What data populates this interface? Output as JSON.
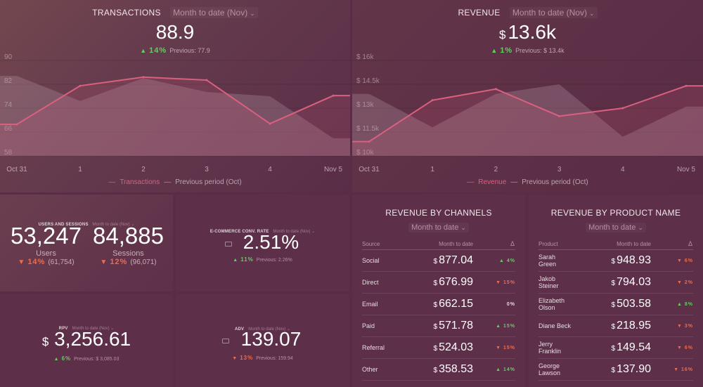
{
  "colors": {
    "series": "#d9607f",
    "previous": "#9a7d8a",
    "up": "#5fcf5f",
    "down": "#ef6b4e"
  },
  "transactions": {
    "title": "TRANSACTIONS",
    "period": "Month to date (Nov)",
    "value": "88.9",
    "change": "14%",
    "direction": "up",
    "previous": "Previous: 77.9",
    "chart_data": {
      "type": "area",
      "x": [
        "Oct 31",
        "1",
        "2",
        "3",
        "4",
        "Nov 5"
      ],
      "yticks": [
        "90",
        "82",
        "74",
        "66",
        "58"
      ],
      "ylim": [
        58,
        90
      ],
      "series": [
        {
          "name": "Transactions",
          "values": [
            68.6,
            81.5,
            84.4,
            83.4,
            68.8,
            78.2
          ]
        },
        {
          "name": "Previous period (Oct)",
          "values": [
            84.8,
            76.4,
            84.1,
            79.4,
            78,
            63.9
          ]
        }
      ]
    }
  },
  "revenue": {
    "title": "REVENUE",
    "period": "Month to date (Nov)",
    "currency": "$",
    "value": "13.6k",
    "change": "1%",
    "direction": "up",
    "previous": "Previous: $ 13.4k",
    "chart_data": {
      "type": "area",
      "x": [
        "Oct 31",
        "1",
        "2",
        "3",
        "4",
        "Nov 5"
      ],
      "yticks": [
        "$ 16k",
        "$ 14.5k",
        "$ 13k",
        "$ 11.5k",
        "$ 10k"
      ],
      "ylim": [
        10000,
        16000
      ],
      "series": [
        {
          "name": "Revenue",
          "values": [
            10900,
            13500,
            14200,
            12500,
            13000,
            14400
          ]
        },
        {
          "name": "Previous period (Oct)",
          "values": [
            13900,
            11800,
            13900,
            14500,
            11200,
            13100
          ]
        }
      ]
    }
  },
  "users_sessions": {
    "title": "USERS AND SESSIONS",
    "period": "Month to date (Nov)",
    "users": {
      "value": "53,247",
      "label": "Users",
      "change": "14%",
      "previous": "(61,754)"
    },
    "sessions": {
      "value": "84,885",
      "label": "Sessions",
      "change": "12%",
      "previous": "(96,071)"
    }
  },
  "conv_rate": {
    "title": "E-COMMERCE CONV. RATE",
    "period": "Month to date (Nov)",
    "value": "2.51%",
    "change": "11%",
    "previous": "Previous: 2.26%"
  },
  "rpv": {
    "title": "RPV",
    "period": "Month to date (Nov)",
    "currency": "$",
    "value": "3,256.61",
    "change": "6%",
    "previous": "Previous: $ 3,085.03"
  },
  "adv": {
    "title": "ADV",
    "period": "Month to date (Nov)",
    "value": "139.07",
    "change": "13%",
    "previous": "Previous: 159.94"
  },
  "channels": {
    "title": "REVENUE BY CHANNELS",
    "period": "Month to date",
    "headers": [
      "Source",
      "Month to date",
      "Δ"
    ],
    "rows": [
      {
        "name": "Social",
        "value": "877.04",
        "change": "4%",
        "dir": "up"
      },
      {
        "name": "Direct",
        "value": "676.99",
        "change": "15%",
        "dir": "down"
      },
      {
        "name": "Email",
        "value": "662.15",
        "change": "0%",
        "dir": "none"
      },
      {
        "name": "Paid",
        "value": "571.78",
        "change": "15%",
        "dir": "up"
      },
      {
        "name": "Referral",
        "value": "524.03",
        "change": "15%",
        "dir": "down"
      },
      {
        "name": "Other",
        "value": "358.53",
        "change": "14%",
        "dir": "up"
      }
    ]
  },
  "products": {
    "title": "REVENUE BY PRODUCT NAME",
    "period": "Month to date",
    "headers": [
      "Product",
      "Month to date",
      "Δ"
    ],
    "rows": [
      {
        "name": "Sarah Green",
        "value": "948.93",
        "change": "6%",
        "dir": "down"
      },
      {
        "name": "Jakob Steiner",
        "value": "794.03",
        "change": "2%",
        "dir": "down"
      },
      {
        "name": "Elizabeth Olson",
        "value": "503.58",
        "change": "8%",
        "dir": "up"
      },
      {
        "name": "Diane Beck",
        "value": "218.95",
        "change": "3%",
        "dir": "down"
      },
      {
        "name": "Jerry Franklin",
        "value": "149.54",
        "change": "6%",
        "dir": "down"
      },
      {
        "name": "George Lawson",
        "value": "137.90",
        "change": "16%",
        "dir": "down"
      }
    ]
  },
  "currency": "$"
}
